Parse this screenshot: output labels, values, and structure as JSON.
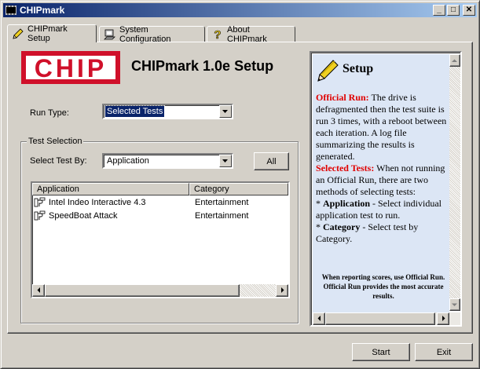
{
  "window": {
    "title": "CHIPmark",
    "minimize_glyph": "_",
    "maximize_glyph": "□",
    "close_glyph": "✕"
  },
  "tabs": [
    {
      "label": "CHIPmark Setup",
      "icon": "pencil-icon",
      "active": true
    },
    {
      "label": "System Configuration",
      "icon": "computer-icon",
      "active": false
    },
    {
      "label": "About CHIPmark",
      "icon": "question-icon",
      "active": false
    }
  ],
  "header": {
    "logo_text": "CHIP",
    "title": "CHIPmark 1.0e Setup"
  },
  "run_type": {
    "label": "Run Type:",
    "value": "Selected Tests"
  },
  "test_selection": {
    "group_label": "Test Selection",
    "select_by_label": "Select Test By:",
    "select_by_value": "Application",
    "all_button": "All",
    "columns": [
      "Application",
      "Category"
    ],
    "rows": [
      {
        "application": "Intel Indeo Interactive 4.3",
        "category": "Entertainment"
      },
      {
        "application": "SpeedBoat Attack",
        "category": "Entertainment"
      }
    ]
  },
  "help": {
    "title": "Setup",
    "official_run_label": "Official Run:",
    "official_run_text": " The drive is defragmented then the test suite is run 3 times, with a reboot between each iteration.  A log file summarizing the results is generated.",
    "selected_tests_label": "Selected Tests:",
    "selected_tests_text": " When not running an Official Run, there are two methods of selecting tests:",
    "bullet1_prefix": "* ",
    "bullet1_bold": "Application",
    "bullet1_text": " - Select individual application test to run.",
    "bullet2_prefix": "* ",
    "bullet2_bold": "Category",
    "bullet2_text": " - Select test by Category.",
    "note": "When reporting scores, use Official Run.  Official Run provides the most accurate results."
  },
  "footer": {
    "start_button": "Start",
    "exit_button": "Exit"
  },
  "colors": {
    "titlebar_start": "#0a246a",
    "titlebar_end": "#a6caf0",
    "logo_red": "#d0102a",
    "help_background": "#dce6f5",
    "help_red": "#e00000"
  }
}
